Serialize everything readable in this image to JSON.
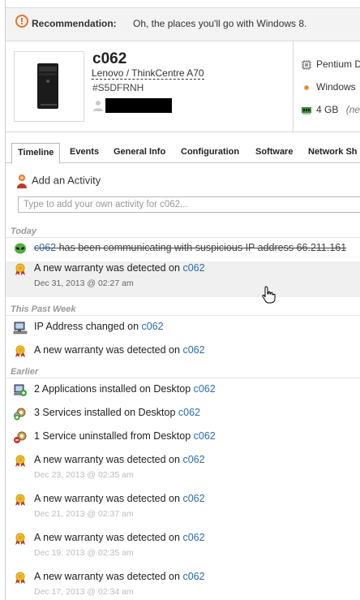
{
  "recommendation": {
    "title": "Recommendation:",
    "text": "Oh, the places you'll go with Windows 8."
  },
  "device": {
    "name": "c062",
    "model": "Lenovo / ThinkCentre A70",
    "serial": "#S5DFRNH",
    "specs": [
      {
        "icon": "cpu-icon",
        "label": "Pentium D"
      },
      {
        "icon": "windows-icon",
        "label": "Windows"
      },
      {
        "icon": "memory-icon",
        "label": "4 GB",
        "note": "(ne"
      }
    ]
  },
  "tabs": [
    "Timeline",
    "Events",
    "General Info",
    "Configuration",
    "Software",
    "Network Sh"
  ],
  "add_activity": {
    "label": "Add an Activity",
    "placeholder": "Type to add your own activity for c062..."
  },
  "sections": {
    "today": "Today",
    "this_past_week": "This Past Week",
    "earlier": "Earlier"
  },
  "timeline": {
    "today": [
      {
        "icon": "alien-icon",
        "link": "c062",
        "text": " has been communicating with suspicious IP address 66.211.161",
        "strike": true
      },
      {
        "icon": "warranty-ribbon-icon",
        "text": "A new warranty was detected on ",
        "link": "c062",
        "date": "Dec 31, 2013 @ 02:27 am"
      }
    ],
    "this_past_week": [
      {
        "icon": "network-computer-icon",
        "text": "IP Address changed on ",
        "link": "c062"
      },
      {
        "icon": "warranty-ribbon-icon",
        "text": "A new warranty was detected on ",
        "link": "c062"
      }
    ],
    "earlier": [
      {
        "icon": "apps-installed-icon",
        "text": "2 Applications installed on Desktop ",
        "link": "c062"
      },
      {
        "icon": "services-installed-icon",
        "text": "3 Services installed on Desktop ",
        "link": "c062"
      },
      {
        "icon": "service-uninstalled-icon",
        "text": "1 Service uninstalled from Desktop ",
        "link": "c062"
      },
      {
        "icon": "warranty-ribbon-icon",
        "text": "A new warranty was detected on ",
        "link": "c062",
        "date": "Dec 23, 2013 @ 02:35 am"
      },
      {
        "icon": "warranty-ribbon-icon",
        "text": "A new warranty was detected on ",
        "link": "c062",
        "date": "Dec 21, 2013 @ 02:37 am"
      },
      {
        "icon": "warranty-ribbon-icon",
        "text": "A new warranty was detected on ",
        "link": "c062",
        "date": "Dec 19, 2013 @ 02:35 am"
      },
      {
        "icon": "warranty-ribbon-icon",
        "text": "A new warranty was detected on ",
        "link": "c062",
        "date": "Dec 17, 2013 @ 02:34 am"
      }
    ]
  },
  "colors": {
    "link": "#2b6cae",
    "section_label": "#999999",
    "accent_orange": "#e8732a"
  }
}
